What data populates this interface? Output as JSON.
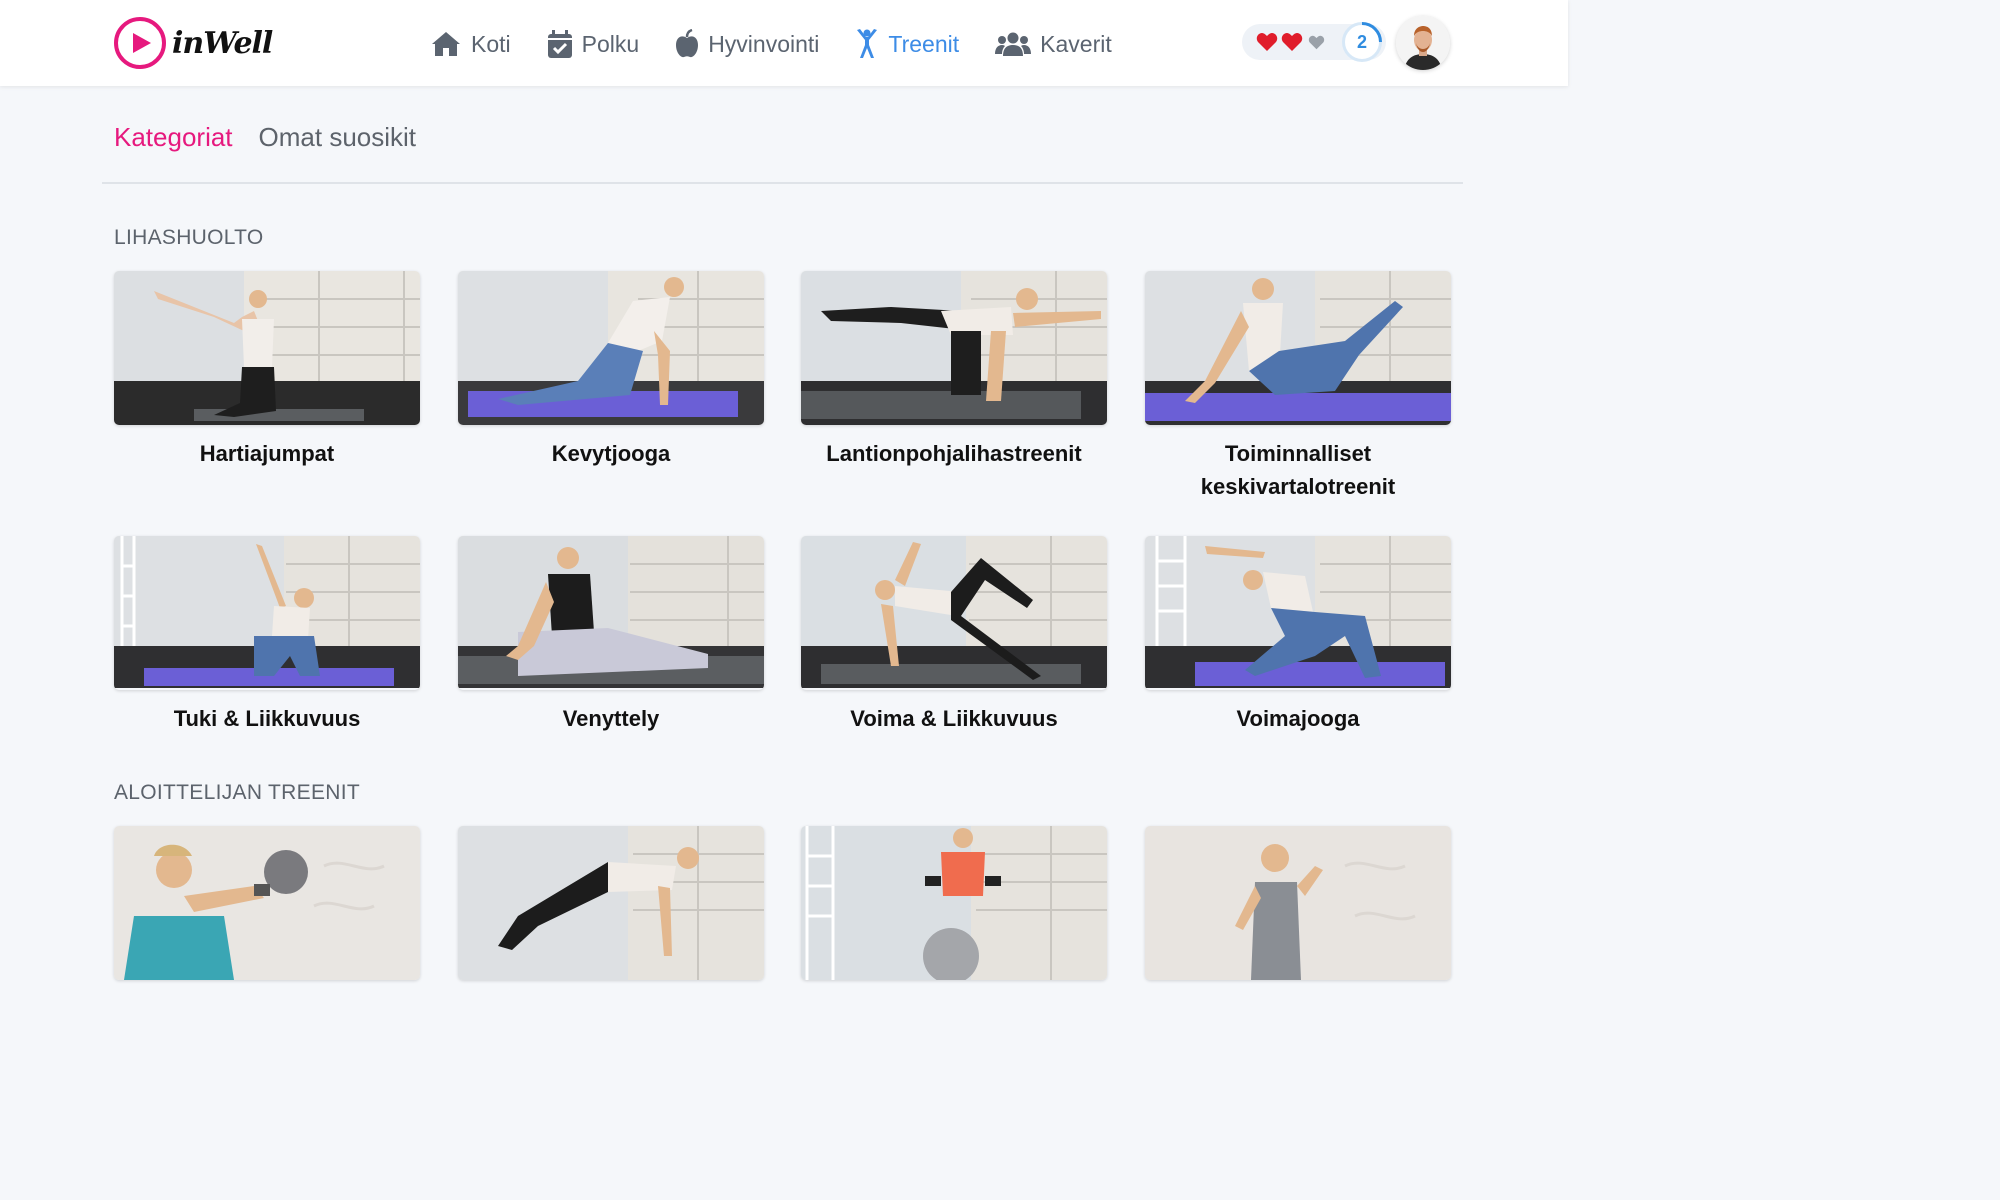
{
  "brand": {
    "name": "inWell",
    "accent": "#e6197e"
  },
  "nav": {
    "items": [
      {
        "label": "Koti",
        "icon": "home-icon"
      },
      {
        "label": "Polku",
        "icon": "calendar-check-icon"
      },
      {
        "label": "Hyvinvointi",
        "icon": "apple-icon"
      },
      {
        "label": "Treenit",
        "icon": "person-icon",
        "active": true
      },
      {
        "label": "Kaverit",
        "icon": "users-icon"
      }
    ],
    "active_color": "#3d8ce6"
  },
  "status": {
    "hearts_full": 2,
    "hearts_total": 3,
    "level": "2"
  },
  "tabs": [
    {
      "label": "Kategoriat",
      "active": true
    },
    {
      "label": "Omat suosikit",
      "active": false
    }
  ],
  "sections": [
    {
      "title": "LIHASHUOLTO",
      "cards": [
        {
          "title": "Hartiajumpat"
        },
        {
          "title": "Kevytjooga"
        },
        {
          "title": "Lantionpohjalihastreenit"
        },
        {
          "title": "Toiminnalliset keskivartalotreenit"
        },
        {
          "title": "Tuki & Liikkuvuus"
        },
        {
          "title": "Venyttely"
        },
        {
          "title": "Voima & Liikkuvuus"
        },
        {
          "title": "Voimajooga"
        }
      ]
    },
    {
      "title": "ALOITTELIJAN TREENIT",
      "cards": [
        {
          "title": ""
        },
        {
          "title": ""
        },
        {
          "title": ""
        },
        {
          "title": ""
        }
      ]
    }
  ]
}
